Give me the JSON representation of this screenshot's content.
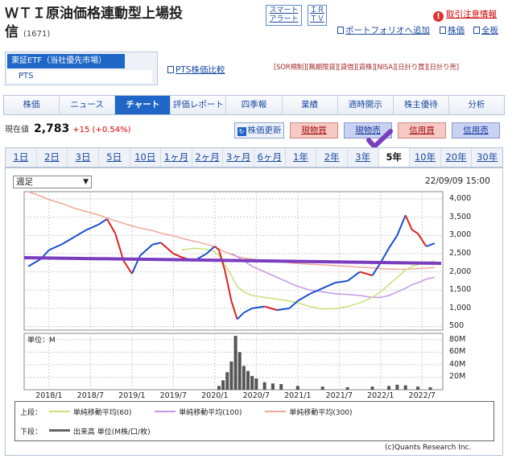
{
  "stock": {
    "name_line1": "ＷＴＩ原油価格連動型上場投",
    "name_line2": "信",
    "code": "(1671)"
  },
  "top_buttons": {
    "alert_top": "スマート",
    "alert_bottom": "アラート",
    "irtv_top": "ＩＲ",
    "irtv_bottom": "ＴＶ"
  },
  "top_links": {
    "notice": "取引注意情報",
    "portfolio": "ポートフォリオへ追加",
    "stock": "株価",
    "all": "全板",
    "pts_compare": "PTS株価比較"
  },
  "market": {
    "primary": "東証ETF（当社優先市場）",
    "pts": "PTS"
  },
  "badges": "[SOR規制][無期限貸][貸借][貸株][NISA][日計り買][日計り売]",
  "tabs": [
    "株価",
    "ニュース",
    "チャート",
    "評価レポート",
    "四季報",
    "業績",
    "適時開示",
    "株主優待",
    "分析"
  ],
  "quote": {
    "label": "現在値",
    "price": "2,783",
    "change": "+15 (+0.54%)"
  },
  "actions": {
    "refresh": "株価更新",
    "spot_buy": "現物買",
    "spot_sell": "現物売",
    "margin_buy": "信用買",
    "margin_sell": "信用売"
  },
  "periods": [
    "1日",
    "2日",
    "3日",
    "5日",
    "10日",
    "1ヶ月",
    "2ヶ月",
    "3ヶ月",
    "6ヶ月",
    "1年",
    "2年",
    "3年",
    "5年",
    "10年",
    "20年",
    "30年"
  ],
  "chart_controls": {
    "interval": "週足",
    "timestamp": "22/09/09 15:00"
  },
  "legend": {
    "upper_label": "上段：",
    "ma60": "単純移動平均(60)",
    "ma100": "単純移動平均(100)",
    "ma300": "単純移動平均(300)",
    "lower_label": "下段：",
    "volume": "出来高 単位(M株/口/枚)"
  },
  "copyright": "(c)Quants Research Inc.",
  "colors": {
    "ma60": "#c8e07a",
    "ma100": "#c496e8",
    "ma300": "#f0a898",
    "annotation": "#7a3dbf",
    "up": "#1a4fd0",
    "down": "#e02020"
  },
  "chart_data": [
    {
      "type": "line",
      "title": "",
      "y_ticks": [
        "4,000",
        "3,500",
        "3,000",
        "2,500",
        "2,000",
        "1,500",
        "1,000",
        "500"
      ],
      "x_ticks": [
        "2018/1",
        "2018/7",
        "2019/1",
        "2019/7",
        "2020/1",
        "2020/7",
        "2021/1",
        "2021/7",
        "2022/1",
        "2022/7"
      ],
      "ylim": [
        400,
        4200
      ],
      "x": [
        2017.75,
        2017.9,
        2018.0,
        2018.15,
        2018.3,
        2018.45,
        2018.6,
        2018.7,
        2018.8,
        2018.9,
        2019.0,
        2019.1,
        2019.25,
        2019.35,
        2019.5,
        2019.6,
        2019.75,
        2019.9,
        2020.0,
        2020.05,
        2020.12,
        2020.2,
        2020.27,
        2020.35,
        2020.45,
        2020.6,
        2020.75,
        2020.9,
        2021.0,
        2021.15,
        2021.3,
        2021.45,
        2021.6,
        2021.75,
        2021.9,
        2022.0,
        2022.1,
        2022.2,
        2022.3,
        2022.38,
        2022.45,
        2022.55,
        2022.65
      ],
      "series": [
        {
          "name": "",
          "values": [
            2150,
            2350,
            2600,
            2750,
            2950,
            3150,
            3300,
            3450,
            3050,
            2300,
            1950,
            2450,
            2750,
            2800,
            2500,
            2400,
            2300,
            2500,
            2700,
            2600,
            2050,
            1200,
            700,
            880,
            1000,
            1050,
            950,
            1000,
            1200,
            1400,
            1550,
            1700,
            1750,
            2000,
            1900,
            2250,
            2650,
            3000,
            3550,
            3150,
            3050,
            2700,
            2783
          ]
        },
        {
          "name": "単純移動平均(60)",
          "values": [
            null,
            null,
            null,
            null,
            null,
            null,
            null,
            null,
            null,
            null,
            null,
            null,
            null,
            null,
            null,
            2600,
            2650,
            2620,
            2550,
            2450,
            2200,
            1900,
            1600,
            1450,
            1350,
            1300,
            1250,
            1200,
            1150,
            1050,
            980,
            990,
            1050,
            1150,
            1300,
            1450,
            1650,
            1850,
            2050,
            2150,
            2200,
            2250,
            2300
          ]
        },
        {
          "name": "単純移動平均(100)",
          "values": [
            null,
            null,
            null,
            null,
            null,
            null,
            null,
            null,
            null,
            null,
            null,
            null,
            null,
            null,
            null,
            null,
            null,
            null,
            null,
            null,
            null,
            2500,
            2420,
            2300,
            2150,
            2000,
            1850,
            1700,
            1600,
            1500,
            1450,
            1400,
            1380,
            1350,
            1300,
            1300,
            1350,
            1450,
            1550,
            1650,
            1700,
            1800,
            1850
          ]
        },
        {
          "name": "単純移動平均(300)",
          "values": [
            4200,
            4080,
            3980,
            3880,
            3750,
            3650,
            3560,
            3480,
            3400,
            3330,
            3260,
            3200,
            3130,
            3060,
            2990,
            2920,
            2840,
            2760,
            2680,
            2620,
            2550,
            2480,
            2420,
            2380,
            2350,
            2310,
            2280,
            2250,
            2230,
            2210,
            2190,
            2170,
            2150,
            2130,
            2110,
            2090,
            2080,
            2070,
            2070,
            2080,
            2090,
            2100,
            2120
          ]
        }
      ]
    },
    {
      "type": "bar",
      "title": "",
      "ylabel": "単位：M",
      "y_ticks": [
        "80M",
        "60M",
        "40M",
        "20M"
      ],
      "ylim": [
        0,
        90
      ],
      "x": [
        2020.05,
        2020.1,
        2020.15,
        2020.2,
        2020.25,
        2020.3,
        2020.35,
        2020.4,
        2020.45,
        2020.5,
        2020.6,
        2020.7,
        2020.8,
        2021.0,
        2021.3,
        2021.6,
        2021.9,
        2022.1,
        2022.2,
        2022.3,
        2022.45,
        2022.6
      ],
      "values": [
        6,
        15,
        28,
        45,
        86,
        60,
        38,
        30,
        22,
        18,
        12,
        10,
        9,
        6,
        5,
        4,
        5,
        6,
        8,
        7,
        5,
        4
      ]
    }
  ]
}
